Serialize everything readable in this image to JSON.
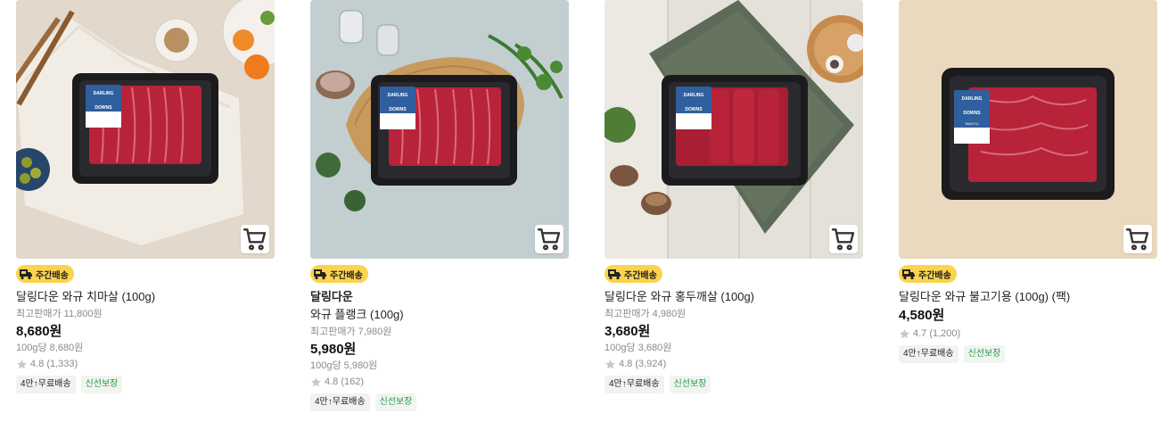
{
  "products": [
    {
      "badge": "주간배송",
      "brand": "",
      "title": "달링다운 와규 치마살 (100g)",
      "original_price": "최고판매가 11,800원",
      "price": "8,680원",
      "unit_price": "100g당 8,680원",
      "rating": "4.8 (1,333)",
      "tags": [
        "4만↑무료배송",
        "신선보장"
      ]
    },
    {
      "badge": "주간배송",
      "brand": "달링다운",
      "title": "와규 플랭크 (100g)",
      "original_price": "최고판매가 7,980원",
      "price": "5,980원",
      "unit_price": "100g당 5,980원",
      "rating": "4.8 (162)",
      "tags": [
        "4만↑무료배송",
        "신선보장"
      ]
    },
    {
      "badge": "주간배송",
      "brand": "",
      "title": "달링다운 와규 홍두깨살 (100g)",
      "original_price": "최고판매가 4,980원",
      "price": "3,680원",
      "unit_price": "100g당 3,680원",
      "rating": "4.8 (3,924)",
      "tags": [
        "4만↑무료배송",
        "신선보장"
      ]
    },
    {
      "badge": "주간배송",
      "brand": "",
      "title": "달링다운 와규 불고기용 (100g) (팩)",
      "original_price": "",
      "price": "4,580원",
      "unit_price": "",
      "rating": "4.7 (1,200)",
      "tags": [
        "4만↑무료배송",
        "신선보장"
      ]
    }
  ],
  "label_text": {
    "brand_line1": "DARLING",
    "brand_line2": "DOWNS",
    "brand_line3": "WAGYU"
  },
  "colors": {
    "badge_bg": "#fbd34d",
    "fresh_tag": "#1a9b3e",
    "muted_text": "#8a8a8a",
    "star": "#c8c8c8",
    "meat": "#b8233a",
    "label_blue": "#2f5f9e"
  },
  "icons": {
    "cart": "shopping-cart-icon",
    "badge": "delivery-truck-icon",
    "rating": "star-icon"
  }
}
